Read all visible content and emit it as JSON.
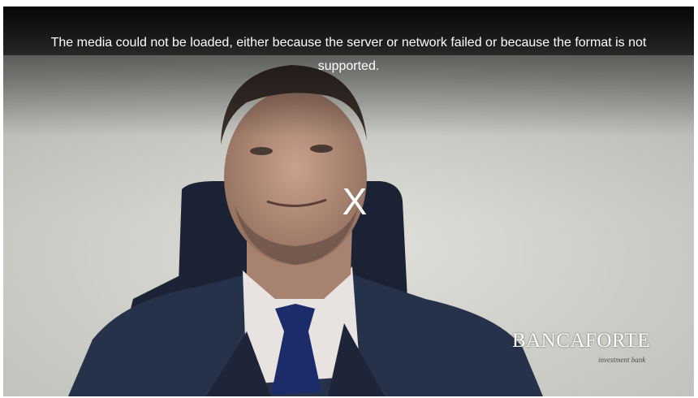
{
  "player": {
    "error_message": "The media could not be loaded, either because the server or network failed or because the format is not supported.",
    "close_glyph": "X"
  },
  "logo": {
    "wordmark": "BANCAFORTE",
    "tagline": "investment bank"
  }
}
